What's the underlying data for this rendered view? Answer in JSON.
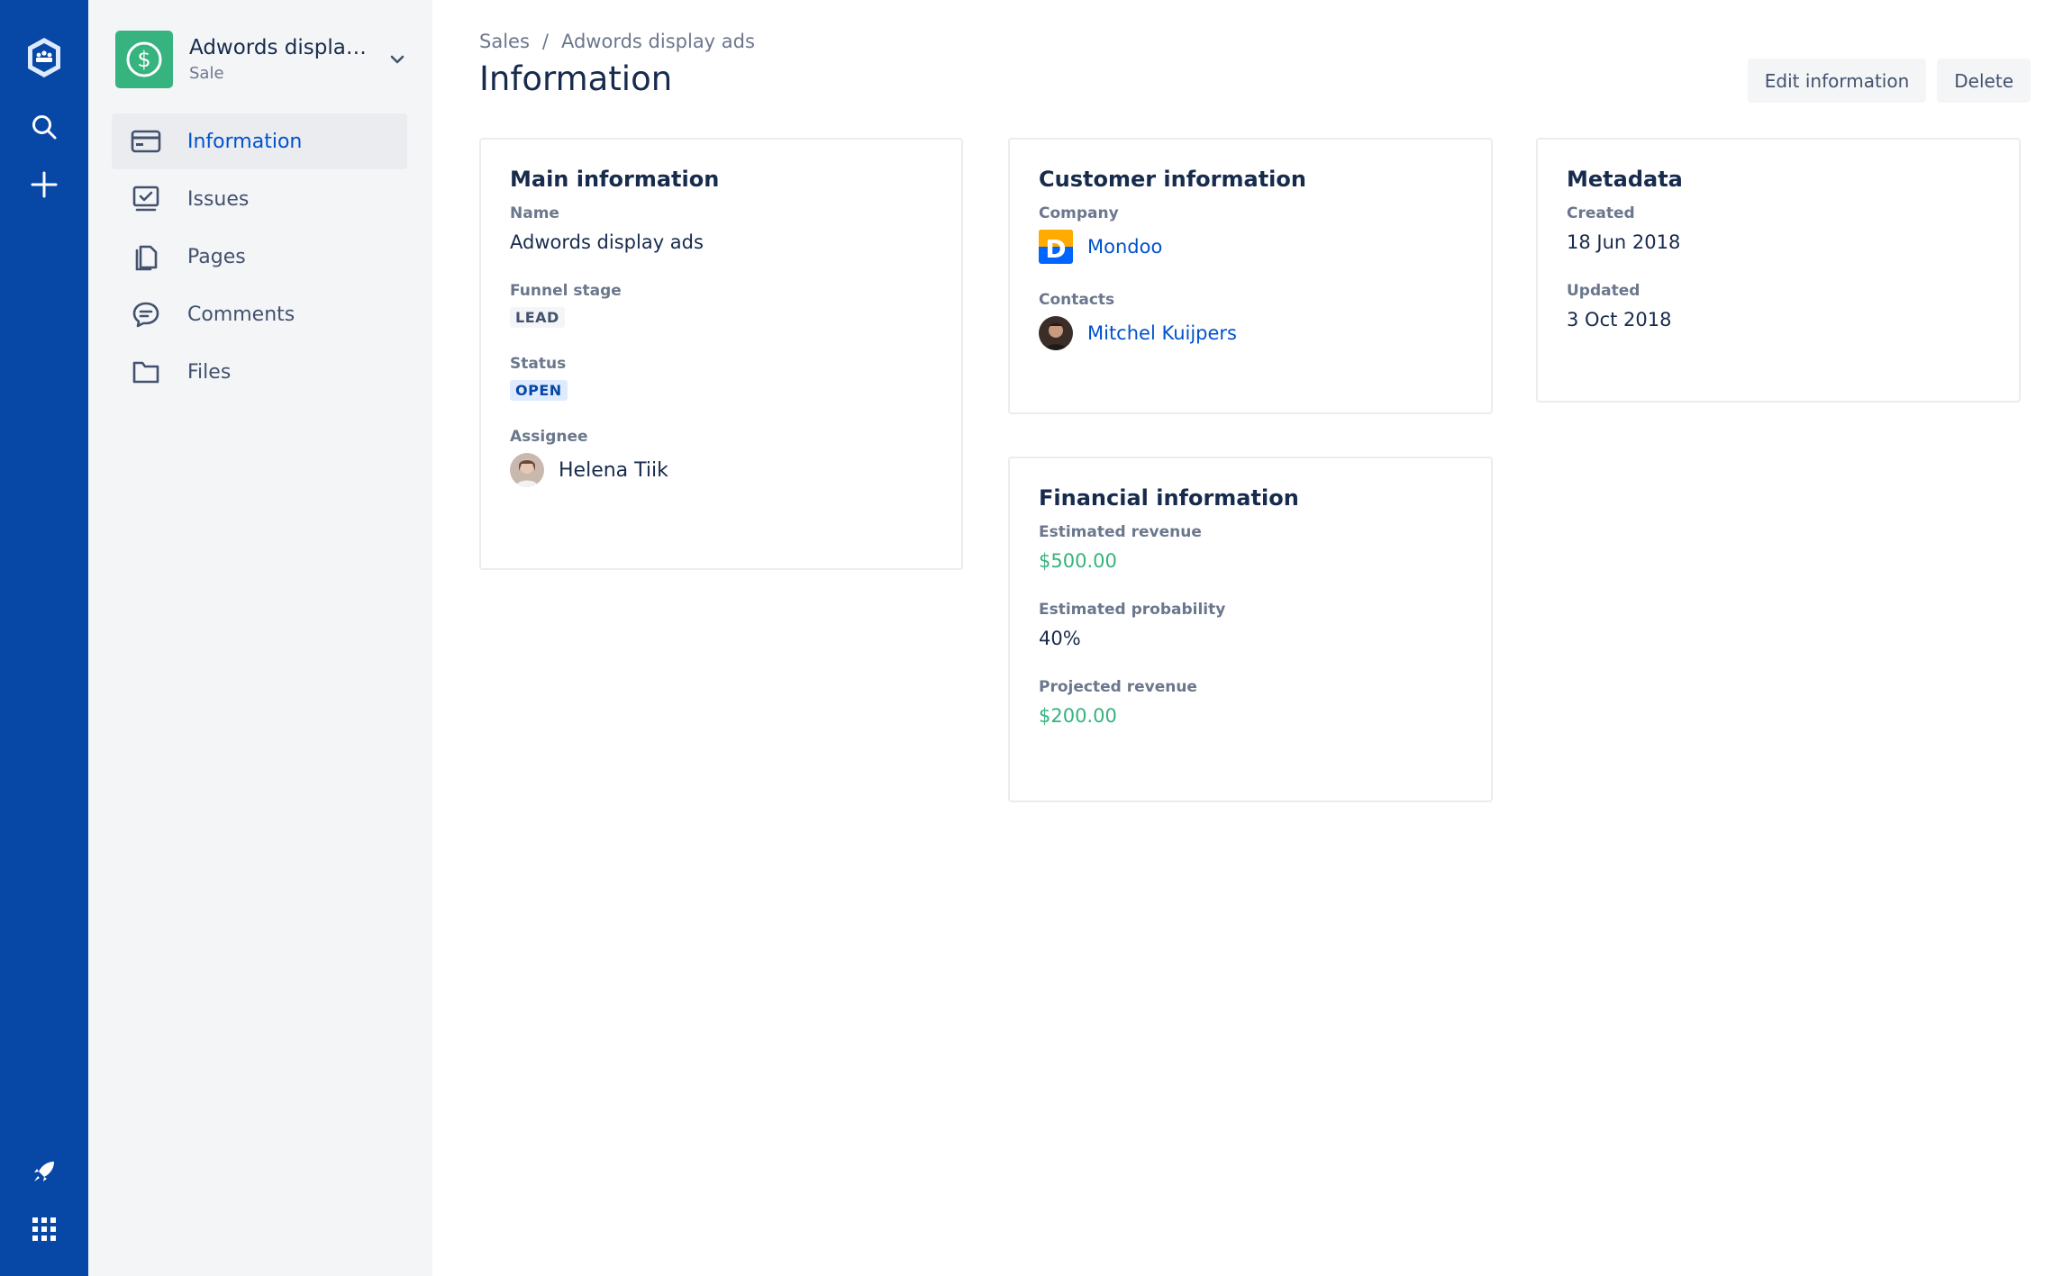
{
  "project": {
    "title": "Adwords display ...",
    "type": "Sale"
  },
  "sidebar": {
    "items": [
      {
        "label": "Information",
        "icon": "credit-card-icon",
        "active": true
      },
      {
        "label": "Issues",
        "icon": "issues-icon",
        "active": false
      },
      {
        "label": "Pages",
        "icon": "pages-icon",
        "active": false
      },
      {
        "label": "Comments",
        "icon": "comments-icon",
        "active": false
      },
      {
        "label": "Files",
        "icon": "folder-icon",
        "active": false
      }
    ]
  },
  "breadcrumb": {
    "root": "Sales",
    "separator": "/",
    "current": "Adwords display ads"
  },
  "page": {
    "title": "Information"
  },
  "actions": {
    "edit_label": "Edit information",
    "delete_label": "Delete"
  },
  "main_info": {
    "heading": "Main information",
    "name_label": "Name",
    "name_value": "Adwords display ads",
    "funnel_label": "Funnel stage",
    "funnel_value": "LEAD",
    "status_label": "Status",
    "status_value": "OPEN",
    "assignee_label": "Assignee",
    "assignee_value": "Helena Tiik"
  },
  "customer_info": {
    "heading": "Customer information",
    "company_label": "Company",
    "company_value": "Mondoo",
    "contacts_label": "Contacts",
    "contact_value": "Mitchel Kuijpers"
  },
  "metadata": {
    "heading": "Metadata",
    "created_label": "Created",
    "created_value": "18 Jun 2018",
    "updated_label": "Updated",
    "updated_value": "3 Oct 2018"
  },
  "financial_info": {
    "heading": "Financial information",
    "est_revenue_label": "Estimated revenue",
    "est_revenue_value": "$500.00",
    "est_probability_label": "Estimated probability",
    "est_probability_value": "40%",
    "proj_revenue_label": "Projected revenue",
    "proj_revenue_value": "$200.00"
  },
  "colors": {
    "global_nav": "#0747A6",
    "sidebar_bg": "#F4F5F7",
    "project_avatar": "#36B37E",
    "link": "#0052CC",
    "money": "#36B37E"
  }
}
